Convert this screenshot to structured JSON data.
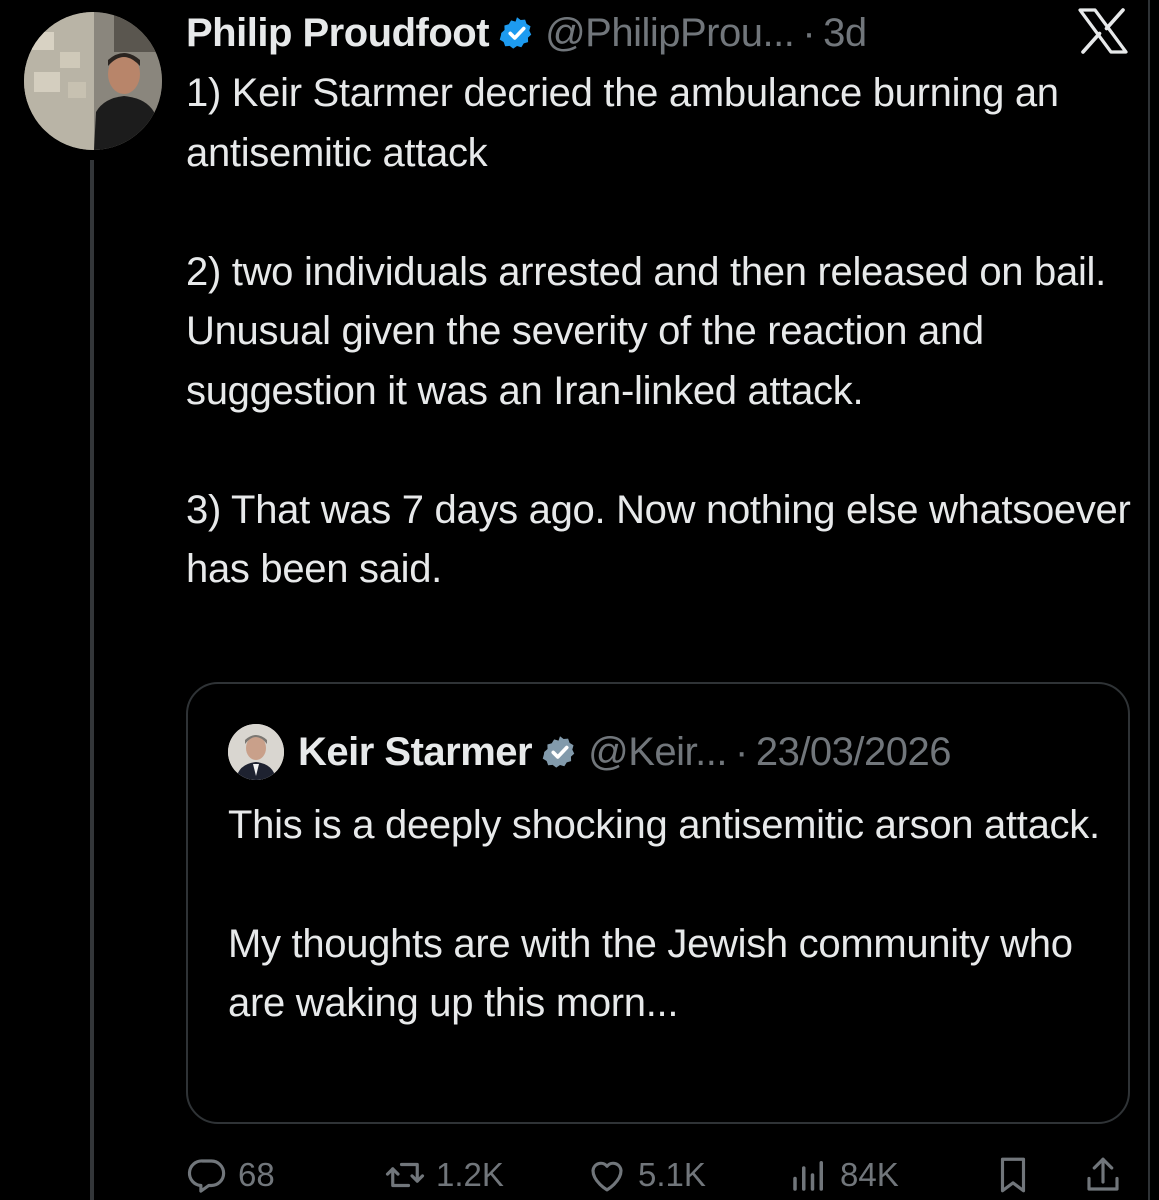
{
  "tweet": {
    "author_name": "Philip Proudfoot",
    "author_handle": "@PhilipProu...",
    "separator": "·",
    "time": "3d",
    "paragraphs": [
      "1) Keir Starmer decried the ambulance burning an antisemitic attack",
      "2) two individuals arrested and then released on bail. Unusual given the severity of the reaction and suggestion it was an Iran-linked attack.",
      "3) That was 7 days ago. Now nothing else whatsoever has been said."
    ]
  },
  "quoted_tweet": {
    "author_name": "Keir Starmer",
    "author_handle": "@Keir...",
    "separator": "·",
    "date": "23/03/2026",
    "paragraphs": [
      "This is a deeply shocking antisemitic arson attack.",
      "My thoughts are with the Jewish community who are waking up this morn..."
    ]
  },
  "actions": {
    "replies": "68",
    "reposts": "1.2K",
    "likes": "5.1K",
    "views": "84K"
  },
  "colors": {
    "background": "#000000",
    "text": "#e7e9ea",
    "muted": "#71767b",
    "verified": "#1d9bf0",
    "border": "#2f3336"
  },
  "icons": [
    "x-logo-icon",
    "verified-badge-icon",
    "reply-icon",
    "repost-icon",
    "like-icon",
    "views-icon",
    "bookmark-icon",
    "share-icon"
  ]
}
